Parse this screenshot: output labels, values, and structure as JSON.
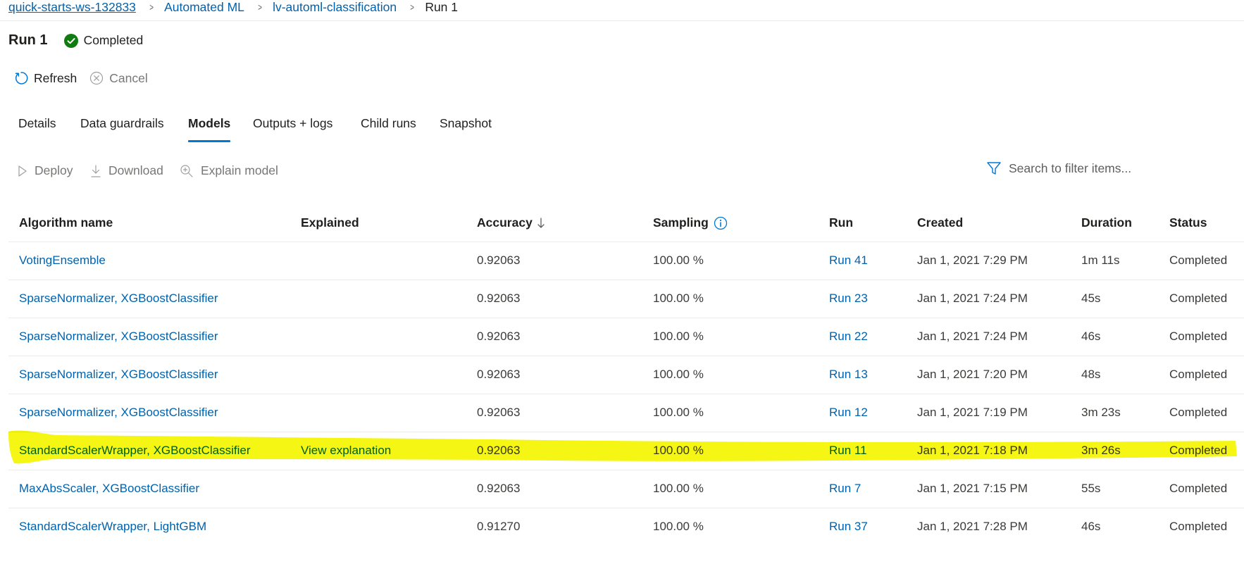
{
  "breadcrumb": {
    "items": [
      "quick-starts-ws-132833",
      "Automated ML",
      "lv-automl-classification"
    ],
    "current": "Run 1",
    "separator": ">"
  },
  "run": {
    "title": "Run 1",
    "status": "Completed",
    "status_color": "#107c10"
  },
  "commands": {
    "refresh": "Refresh",
    "cancel": "Cancel"
  },
  "tabs": [
    "Details",
    "Data guardrails",
    "Models",
    "Outputs + logs",
    "Child runs",
    "Snapshot"
  ],
  "active_tab": "Models",
  "actions": {
    "deploy": "Deploy",
    "download": "Download",
    "explain": "Explain model"
  },
  "search": {
    "placeholder": "Search to filter items..."
  },
  "grid": {
    "columns": [
      "Algorithm name",
      "Explained",
      "Accuracy",
      "Sampling",
      "Run",
      "Created",
      "Duration",
      "Status"
    ],
    "sorted_column": "Accuracy",
    "sort_direction": "descending",
    "rows": [
      {
        "algorithm": "VotingEnsemble",
        "explained": "",
        "accuracy": "0.92063",
        "sampling": "100.00 %",
        "run": "Run 41",
        "created": "Jan 1, 2021 7:29 PM",
        "duration": "1m 11s",
        "status": "Completed"
      },
      {
        "algorithm": "SparseNormalizer, XGBoostClassifier",
        "explained": "",
        "accuracy": "0.92063",
        "sampling": "100.00 %",
        "run": "Run 23",
        "created": "Jan 1, 2021 7:24 PM",
        "duration": "45s",
        "status": "Completed"
      },
      {
        "algorithm": "SparseNormalizer, XGBoostClassifier",
        "explained": "",
        "accuracy": "0.92063",
        "sampling": "100.00 %",
        "run": "Run 22",
        "created": "Jan 1, 2021 7:24 PM",
        "duration": "46s",
        "status": "Completed"
      },
      {
        "algorithm": "SparseNormalizer, XGBoostClassifier",
        "explained": "",
        "accuracy": "0.92063",
        "sampling": "100.00 %",
        "run": "Run 13",
        "created": "Jan 1, 2021 7:20 PM",
        "duration": "48s",
        "status": "Completed"
      },
      {
        "algorithm": "SparseNormalizer, XGBoostClassifier",
        "explained": "",
        "accuracy": "0.92063",
        "sampling": "100.00 %",
        "run": "Run 12",
        "created": "Jan 1, 2021 7:19 PM",
        "duration": "3m 23s",
        "status": "Completed"
      },
      {
        "algorithm": "StandardScalerWrapper, XGBoostClassifier",
        "explained": "View explanation",
        "accuracy": "0.92063",
        "sampling": "100.00 %",
        "run": "Run 11",
        "created": "Jan 1, 2021 7:18 PM",
        "duration": "3m 26s",
        "status": "Completed"
      },
      {
        "algorithm": "MaxAbsScaler, XGBoostClassifier",
        "explained": "",
        "accuracy": "0.92063",
        "sampling": "100.00 %",
        "run": "Run 7",
        "created": "Jan 1, 2021 7:15 PM",
        "duration": "55s",
        "status": "Completed"
      },
      {
        "algorithm": "StandardScalerWrapper, LightGBM",
        "explained": "",
        "accuracy": "0.91270",
        "sampling": "100.00 %",
        "run": "Run 37",
        "created": "Jan 1, 2021 7:28 PM",
        "duration": "46s",
        "status": "Completed"
      }
    ]
  },
  "colors": {
    "link": "#0062ad",
    "accent": "#0078d4",
    "highlighter": "#f5f500"
  }
}
